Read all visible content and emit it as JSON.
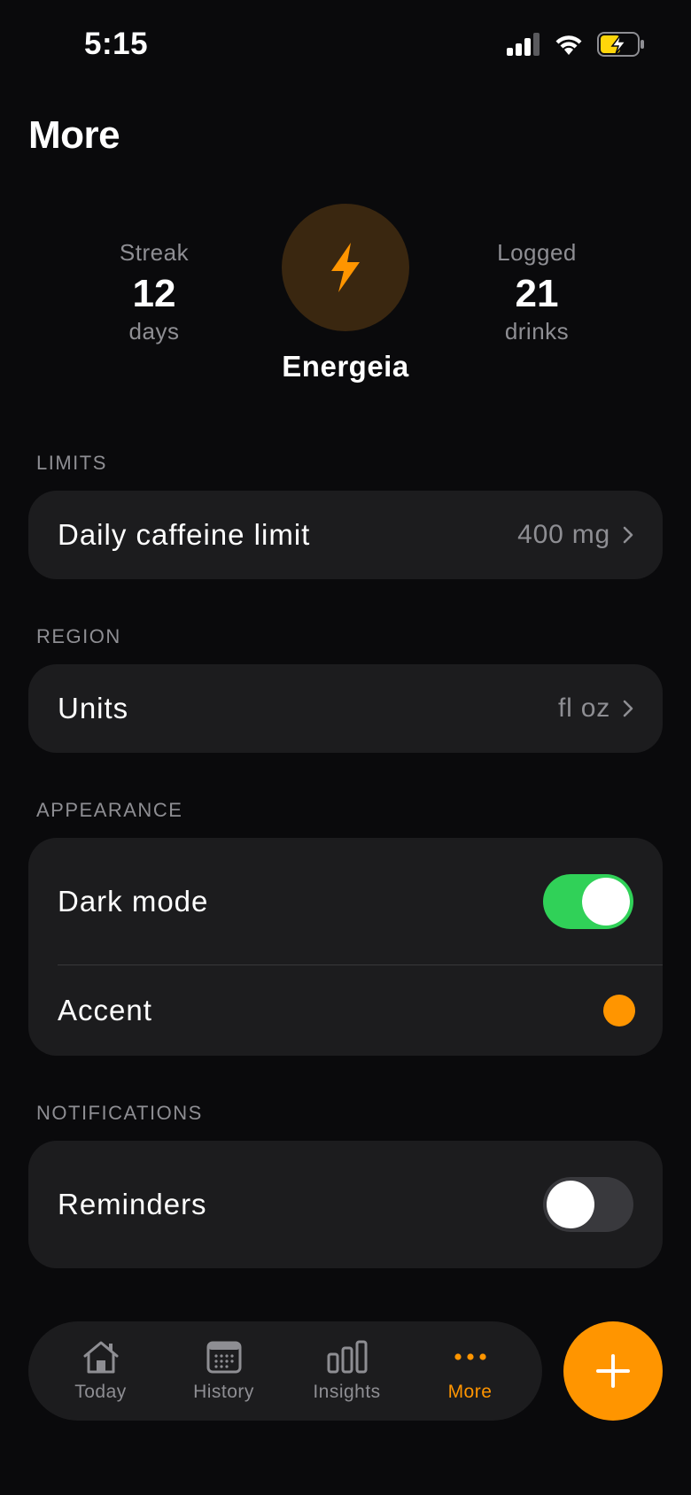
{
  "status_bar": {
    "time": "5:15"
  },
  "page": {
    "title": "More"
  },
  "profile": {
    "app_name": "Energeia",
    "streak": {
      "label": "Streak",
      "value": "12",
      "unit": "days"
    },
    "logged": {
      "label": "Logged",
      "value": "21",
      "unit": "drinks"
    }
  },
  "sections": {
    "limits": {
      "header": "LIMITS",
      "daily_limit": {
        "label": "Daily caffeine limit",
        "value": "400 mg"
      }
    },
    "region": {
      "header": "REGION",
      "units": {
        "label": "Units",
        "value": "fl oz"
      }
    },
    "appearance": {
      "header": "APPEARANCE",
      "dark_mode": {
        "label": "Dark mode",
        "enabled": true
      },
      "accent": {
        "label": "Accent",
        "color": "#ff9500"
      }
    },
    "notifications": {
      "header": "NOTIFICATIONS",
      "reminders": {
        "label": "Reminders",
        "enabled": false
      }
    }
  },
  "tab_bar": {
    "items": [
      {
        "label": "Today",
        "icon": "house-icon",
        "active": false
      },
      {
        "label": "History",
        "icon": "calendar-icon",
        "active": false
      },
      {
        "label": "Insights",
        "icon": "bar-chart-icon",
        "active": false
      },
      {
        "label": "More",
        "icon": "ellipsis-icon",
        "active": true
      }
    ]
  },
  "fab": {
    "icon": "plus-icon"
  },
  "colors": {
    "accent": "#ff9500",
    "toggle_on": "#30d158",
    "card": "#1c1c1e",
    "background": "#0a0a0c"
  }
}
